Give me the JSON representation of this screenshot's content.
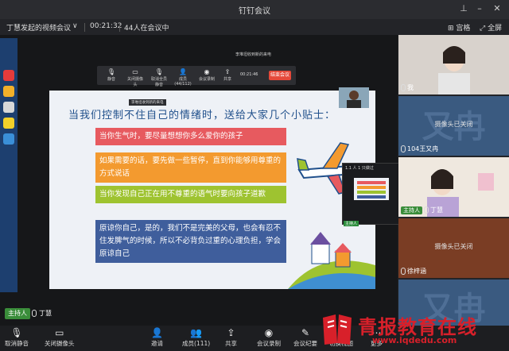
{
  "window": {
    "title": "钉钉会议"
  },
  "infobar": {
    "meeting_title": "丁慧发起的视频会议",
    "chevron": "∨",
    "duration": "00:21:32",
    "participants_status": "44人在会议中",
    "grid_label": "宫格",
    "fullscreen_label": "全屏"
  },
  "remote": {
    "tip": "李堆坦收到新的来电",
    "time": "00:21:46",
    "end_label": "结束会议",
    "mini_tip": "李堆坦收到新的来电",
    "toolbar": [
      "静音",
      "关闭摄像头",
      "取消全员静音",
      "成员(44/112)",
      "会议录制",
      "共享"
    ]
  },
  "slide": {
    "title": "当我们控制不住自己的情绪时，送给大家几个小贴士：",
    "tips": [
      "当你生气时，要尽量想想你多么爱你的孩子",
      "如果需要的话，要先做一些暂停，直到你能够用尊重的方式说话",
      "当你发现自己正在用不尊重的语气时要向孩子道歉",
      "原谅你自己，是的，我们不是完美的父母，也会有忍不住发脾气的时候，所以不必背负过重的心理负担，学会原谅自己"
    ],
    "embedded_label": "主持人",
    "embedded_mini_title": "1.1 人 1 只做过"
  },
  "stage": {
    "host_tag": "主持人",
    "host_name": "丁慧"
  },
  "participants": [
    {
      "name": "我",
      "badge": "",
      "center": ""
    },
    {
      "name": "104王又冉",
      "badge": "",
      "center": "摄像头已关闭"
    },
    {
      "name": "丁慧",
      "badge": "主持人",
      "center": ""
    },
    {
      "name": "徐梓涵",
      "badge": "",
      "center": "摄像头已关闭"
    }
  ],
  "toolbar": {
    "unmute": "取消静音",
    "camera": "关闭摄像头",
    "invite": "邀请",
    "members": "成员(111)",
    "share": "共享",
    "record": "会议录制",
    "minutes": "会议纪要",
    "view": "切换视图",
    "more": "更多"
  },
  "watermark": {
    "brand": "青报教育在线",
    "url": "www.iqdedu.com"
  },
  "colors": {
    "tip1": "#e75a5f",
    "tip2": "#f39a2f",
    "tip3": "#9ec330",
    "tip4": "#3f5e9c",
    "end": "#e5493a",
    "host": "#3a8d3a"
  }
}
